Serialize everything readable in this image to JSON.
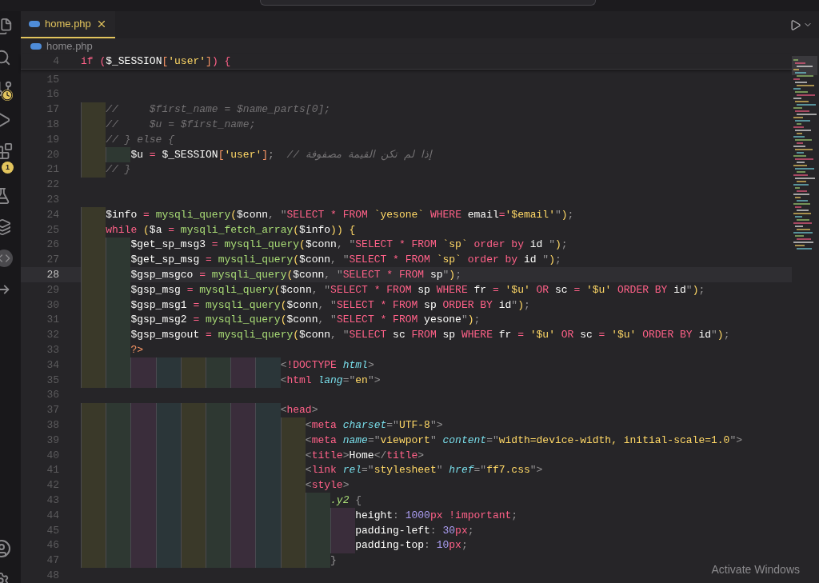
{
  "tabs": [
    {
      "label": "home.php",
      "selected": true
    }
  ],
  "breadcrumb": "home.php",
  "activity_bar": {
    "badge": "1"
  },
  "sticky_scroll": {
    "number": "4",
    "tokens": [
      {
        "kind": "keyword",
        "text": "if"
      },
      {
        "kind": "keyword",
        "text": " ("
      },
      {
        "kind": "variable",
        "text": "$_SESSION"
      },
      {
        "kind": "php",
        "text": "["
      },
      {
        "kind": "string",
        "text": "'user'"
      },
      {
        "kind": "php",
        "text": "]"
      },
      {
        "kind": "keyword",
        "text": ") {"
      }
    ]
  },
  "lines": [
    {
      "number": "15",
      "current": false
    },
    {
      "number": "16",
      "current": false
    },
    {
      "number": "17",
      "current": false,
      "guides": [
        {
          "color": "#3a3929"
        }
      ],
      "tokens": [
        {
          "kind": "comment",
          "text": "//     $first_name = $name_parts[0];"
        }
      ]
    },
    {
      "number": "18",
      "current": false,
      "guides": [
        {
          "color": "#3a3929"
        }
      ],
      "tokens": [
        {
          "kind": "comment",
          "text": "//     $u = $first_name;"
        }
      ]
    },
    {
      "number": "19",
      "current": false,
      "guides": [
        {
          "color": "#3a3929"
        }
      ],
      "tokens": [
        {
          "kind": "comment",
          "text": "// } else {"
        }
      ]
    },
    {
      "number": "20",
      "current": false,
      "guides": [
        {
          "color": "#3a3929"
        },
        {
          "color": "#2e3832"
        }
      ],
      "tokens": [
        {
          "kind": "variable",
          "text": "$u"
        },
        {
          "kind": "keyword",
          "text": " = "
        },
        {
          "kind": "variable",
          "text": "$_SESSION"
        },
        {
          "kind": "php",
          "text": "["
        },
        {
          "kind": "string",
          "text": "'user'"
        },
        {
          "kind": "php",
          "text": "]"
        },
        {
          "kind": "punctuation",
          "text": ";  "
        },
        {
          "kind": "comment",
          "text": "// إذا لم تكن القيمة مصفوفة"
        }
      ]
    },
    {
      "number": "21",
      "current": false,
      "guides": [
        {
          "color": "#3a3929"
        }
      ],
      "tokens": [
        {
          "kind": "comment",
          "text": "// }"
        }
      ]
    },
    {
      "number": "22",
      "current": false
    },
    {
      "number": "23",
      "current": false
    },
    {
      "number": "24",
      "current": false,
      "guides": [
        {
          "color": "#3a3929"
        }
      ],
      "tokens": [
        {
          "kind": "variable",
          "text": "$info"
        },
        {
          "kind": "keyword",
          "text": " = "
        },
        {
          "kind": "function",
          "text": "mysqli_query"
        },
        {
          "kind": "bracket",
          "text": "("
        },
        {
          "kind": "variable",
          "text": "$conn"
        },
        {
          "kind": "punctuation",
          "text": ", \""
        },
        {
          "kind": "keyword",
          "text": "SELECT * FROM "
        },
        {
          "kind": "string",
          "text": "`yesone`"
        },
        {
          "kind": "keyword",
          "text": " WHERE "
        },
        {
          "kind": "variable",
          "text": "email"
        },
        {
          "kind": "keyword",
          "text": "="
        },
        {
          "kind": "string",
          "text": "'$email'"
        },
        {
          "kind": "punctuation",
          "text": "\""
        },
        {
          "kind": "bracket",
          "text": ")"
        },
        {
          "kind": "punctuation",
          "text": ";"
        }
      ]
    },
    {
      "number": "25",
      "current": false,
      "guides": [
        {
          "color": "#3a3929"
        }
      ],
      "tokens": [
        {
          "kind": "keyword",
          "text": "while "
        },
        {
          "kind": "bracket",
          "text": "("
        },
        {
          "kind": "variable",
          "text": "$a"
        },
        {
          "kind": "keyword",
          "text": " = "
        },
        {
          "kind": "function",
          "text": "mysqli_fetch_array"
        },
        {
          "kind": "bracket",
          "text": "("
        },
        {
          "kind": "variable",
          "text": "$info"
        },
        {
          "kind": "bracket",
          "text": ")) {"
        }
      ]
    },
    {
      "number": "26",
      "current": false,
      "guides": [
        {
          "color": "#3a3929"
        },
        {
          "color": "#2e3832"
        }
      ],
      "tokens": [
        {
          "kind": "variable",
          "text": "$get_sp_msg3"
        },
        {
          "kind": "keyword",
          "text": " = "
        },
        {
          "kind": "function",
          "text": "mysqli_query"
        },
        {
          "kind": "bracket",
          "text": "("
        },
        {
          "kind": "variable",
          "text": "$conn"
        },
        {
          "kind": "punctuation",
          "text": ", \""
        },
        {
          "kind": "keyword",
          "text": "SELECT * FROM "
        },
        {
          "kind": "string",
          "text": "`sp`"
        },
        {
          "kind": "keyword",
          "text": " order by "
        },
        {
          "kind": "variable",
          "text": "id "
        },
        {
          "kind": "punctuation",
          "text": "\""
        },
        {
          "kind": "bracket",
          "text": ")"
        },
        {
          "kind": "punctuation",
          "text": ";"
        }
      ]
    },
    {
      "number": "27",
      "current": false,
      "guides": [
        {
          "color": "#3a3929"
        },
        {
          "color": "#2e3832"
        }
      ],
      "tokens": [
        {
          "kind": "variable",
          "text": "$get_sp_msg"
        },
        {
          "kind": "keyword",
          "text": " = "
        },
        {
          "kind": "function",
          "text": "mysqli_query"
        },
        {
          "kind": "bracket",
          "text": "("
        },
        {
          "kind": "variable",
          "text": "$conn"
        },
        {
          "kind": "punctuation",
          "text": ", \""
        },
        {
          "kind": "keyword",
          "text": "SELECT * FROM "
        },
        {
          "kind": "string",
          "text": "`sp`"
        },
        {
          "kind": "keyword",
          "text": " order by "
        },
        {
          "kind": "variable",
          "text": "id "
        },
        {
          "kind": "punctuation",
          "text": "\""
        },
        {
          "kind": "bracket",
          "text": ")"
        },
        {
          "kind": "punctuation",
          "text": ";"
        }
      ]
    },
    {
      "number": "28",
      "current": true,
      "guides": [
        {
          "color": "#3a3929"
        },
        {
          "color": "#2e3832"
        }
      ],
      "tokens": [
        {
          "kind": "variable",
          "text": "$gsp_msgco"
        },
        {
          "kind": "keyword",
          "text": " = "
        },
        {
          "kind": "function",
          "text": "mysqli_query"
        },
        {
          "kind": "bracket",
          "text": "("
        },
        {
          "kind": "variable",
          "text": "$conn"
        },
        {
          "kind": "punctuation",
          "text": ", \""
        },
        {
          "kind": "keyword",
          "text": "SELECT * FROM "
        },
        {
          "kind": "variable",
          "text": "sp"
        },
        {
          "kind": "punctuation",
          "text": "\""
        },
        {
          "kind": "bracket",
          "text": ")"
        },
        {
          "kind": "punctuation",
          "text": ";"
        }
      ]
    },
    {
      "number": "29",
      "current": false,
      "guides": [
        {
          "color": "#3a3929"
        },
        {
          "color": "#2e3832"
        }
      ],
      "tokens": [
        {
          "kind": "variable",
          "text": "$gsp_msg"
        },
        {
          "kind": "keyword",
          "text": " = "
        },
        {
          "kind": "function",
          "text": "mysqli_query"
        },
        {
          "kind": "bracket",
          "text": "("
        },
        {
          "kind": "variable",
          "text": "$conn"
        },
        {
          "kind": "punctuation",
          "text": ", \""
        },
        {
          "kind": "keyword",
          "text": "SELECT * FROM "
        },
        {
          "kind": "variable",
          "text": "sp "
        },
        {
          "kind": "keyword",
          "text": "WHERE "
        },
        {
          "kind": "variable",
          "text": "fr "
        },
        {
          "kind": "keyword",
          "text": "= "
        },
        {
          "kind": "string",
          "text": "'$u' "
        },
        {
          "kind": "keyword",
          "text": "OR "
        },
        {
          "kind": "variable",
          "text": "sc "
        },
        {
          "kind": "keyword",
          "text": "= "
        },
        {
          "kind": "string",
          "text": "'$u' "
        },
        {
          "kind": "keyword",
          "text": "ORDER BY "
        },
        {
          "kind": "variable",
          "text": "id"
        },
        {
          "kind": "punctuation",
          "text": "\""
        },
        {
          "kind": "bracket",
          "text": ")"
        },
        {
          "kind": "punctuation",
          "text": ";"
        }
      ]
    },
    {
      "number": "30",
      "current": false,
      "guides": [
        {
          "color": "#3a3929"
        },
        {
          "color": "#2e3832"
        }
      ],
      "tokens": [
        {
          "kind": "variable",
          "text": "$gsp_msg1"
        },
        {
          "kind": "keyword",
          "text": " = "
        },
        {
          "kind": "function",
          "text": "mysqli_query"
        },
        {
          "kind": "bracket",
          "text": "("
        },
        {
          "kind": "variable",
          "text": "$conn"
        },
        {
          "kind": "punctuation",
          "text": ", \""
        },
        {
          "kind": "keyword",
          "text": "SELECT * FROM "
        },
        {
          "kind": "variable",
          "text": "sp "
        },
        {
          "kind": "keyword",
          "text": "ORDER BY "
        },
        {
          "kind": "variable",
          "text": "id"
        },
        {
          "kind": "punctuation",
          "text": "\""
        },
        {
          "kind": "bracket",
          "text": ")"
        },
        {
          "kind": "punctuation",
          "text": ";"
        }
      ]
    },
    {
      "number": "31",
      "current": false,
      "guides": [
        {
          "color": "#3a3929"
        },
        {
          "color": "#2e3832"
        }
      ],
      "tokens": [
        {
          "kind": "variable",
          "text": "$gsp_msg2"
        },
        {
          "kind": "keyword",
          "text": " = "
        },
        {
          "kind": "function",
          "text": "mysqli_query"
        },
        {
          "kind": "bracket",
          "text": "("
        },
        {
          "kind": "variable",
          "text": "$conn"
        },
        {
          "kind": "punctuation",
          "text": ", \""
        },
        {
          "kind": "keyword",
          "text": "SELECT * FROM "
        },
        {
          "kind": "variable",
          "text": "yesone"
        },
        {
          "kind": "punctuation",
          "text": "\""
        },
        {
          "kind": "bracket",
          "text": ")"
        },
        {
          "kind": "punctuation",
          "text": ";"
        }
      ]
    },
    {
      "number": "32",
      "current": false,
      "guides": [
        {
          "color": "#3a3929"
        },
        {
          "color": "#2e3832"
        }
      ],
      "tokens": [
        {
          "kind": "variable",
          "text": "$gsp_msgout"
        },
        {
          "kind": "keyword",
          "text": " = "
        },
        {
          "kind": "function",
          "text": "mysqli_query"
        },
        {
          "kind": "bracket",
          "text": "("
        },
        {
          "kind": "variable",
          "text": "$conn"
        },
        {
          "kind": "punctuation",
          "text": ", \""
        },
        {
          "kind": "keyword",
          "text": "SELECT "
        },
        {
          "kind": "variable",
          "text": "sc "
        },
        {
          "kind": "keyword",
          "text": "FROM "
        },
        {
          "kind": "variable",
          "text": "sp "
        },
        {
          "kind": "keyword",
          "text": "WHERE "
        },
        {
          "kind": "variable",
          "text": "fr "
        },
        {
          "kind": "keyword",
          "text": "= "
        },
        {
          "kind": "string",
          "text": "'$u' "
        },
        {
          "kind": "keyword",
          "text": "OR "
        },
        {
          "kind": "variable",
          "text": "sc "
        },
        {
          "kind": "keyword",
          "text": "= "
        },
        {
          "kind": "string",
          "text": "'$u' "
        },
        {
          "kind": "keyword",
          "text": "ORDER BY "
        },
        {
          "kind": "variable",
          "text": "id"
        },
        {
          "kind": "punctuation",
          "text": "\""
        },
        {
          "kind": "bracket",
          "text": ")"
        },
        {
          "kind": "punctuation",
          "text": ";"
        }
      ]
    },
    {
      "number": "33",
      "current": false,
      "guides": [
        {
          "color": "#3a3929"
        },
        {
          "color": "#2e3832"
        }
      ],
      "tokens": [
        {
          "kind": "php",
          "text": "?>"
        }
      ]
    },
    {
      "number": "34",
      "current": false,
      "guides": [
        {
          "color": "#3a3929"
        },
        {
          "color": "#2e3832"
        },
        {
          "color": "#3a2d3b"
        },
        {
          "color": "#2b3639"
        },
        {
          "color": "#3a3929"
        },
        {
          "color": "#2e3832"
        },
        {
          "color": "#3a2d3b"
        },
        {
          "color": "#2b3639"
        }
      ],
      "tokens": [
        {
          "kind": "punctuation",
          "text": "<"
        },
        {
          "kind": "keyword",
          "text": "!DOCTYPE "
        },
        {
          "kind": "attribute",
          "text": "html"
        },
        {
          "kind": "punctuation",
          "text": ">"
        }
      ]
    },
    {
      "number": "35",
      "current": false,
      "guides": [
        {
          "color": "#3a3929"
        },
        {
          "color": "#2e3832"
        },
        {
          "color": "#3a2d3b"
        },
        {
          "color": "#2b3639"
        },
        {
          "color": "#3a3929"
        },
        {
          "color": "#2e3832"
        },
        {
          "color": "#3a2d3b"
        },
        {
          "color": "#2b3639"
        }
      ],
      "tokens": [
        {
          "kind": "punctuation",
          "text": "<"
        },
        {
          "kind": "keyword",
          "text": "html "
        },
        {
          "kind": "attribute",
          "text": "lang"
        },
        {
          "kind": "punctuation",
          "text": "=\""
        },
        {
          "kind": "string",
          "text": "en"
        },
        {
          "kind": "punctuation",
          "text": "\">"
        }
      ]
    },
    {
      "number": "36",
      "current": false
    },
    {
      "number": "37",
      "current": false,
      "guides": [
        {
          "color": "#3a3929"
        },
        {
          "color": "#2e3832"
        },
        {
          "color": "#3a2d3b"
        },
        {
          "color": "#2b3639"
        },
        {
          "color": "#3a3929"
        },
        {
          "color": "#2e3832"
        },
        {
          "color": "#3a2d3b"
        },
        {
          "color": "#2b3639"
        }
      ],
      "tokens": [
        {
          "kind": "punctuation",
          "text": "<"
        },
        {
          "kind": "keyword",
          "text": "head"
        },
        {
          "kind": "punctuation",
          "text": ">"
        }
      ]
    },
    {
      "number": "38",
      "current": false,
      "guides": [
        {
          "color": "#3a3929"
        },
        {
          "color": "#2e3832"
        },
        {
          "color": "#3a2d3b"
        },
        {
          "color": "#2b3639"
        },
        {
          "color": "#3a3929"
        },
        {
          "color": "#2e3832"
        },
        {
          "color": "#3a2d3b"
        },
        {
          "color": "#2b3639"
        },
        {
          "color": "#3a3929"
        }
      ],
      "tokens": [
        {
          "kind": "punctuation",
          "text": "<"
        },
        {
          "kind": "keyword",
          "text": "meta "
        },
        {
          "kind": "attribute",
          "text": "charset"
        },
        {
          "kind": "punctuation",
          "text": "=\""
        },
        {
          "kind": "string",
          "text": "UTF-8"
        },
        {
          "kind": "punctuation",
          "text": "\">"
        }
      ]
    },
    {
      "number": "39",
      "current": false,
      "guides": [
        {
          "color": "#3a3929"
        },
        {
          "color": "#2e3832"
        },
        {
          "color": "#3a2d3b"
        },
        {
          "color": "#2b3639"
        },
        {
          "color": "#3a3929"
        },
        {
          "color": "#2e3832"
        },
        {
          "color": "#3a2d3b"
        },
        {
          "color": "#2b3639"
        },
        {
          "color": "#3a3929"
        }
      ],
      "tokens": [
        {
          "kind": "punctuation",
          "text": "<"
        },
        {
          "kind": "keyword",
          "text": "meta "
        },
        {
          "kind": "attribute",
          "text": "name"
        },
        {
          "kind": "punctuation",
          "text": "=\""
        },
        {
          "kind": "string",
          "text": "viewport"
        },
        {
          "kind": "punctuation",
          "text": "\" "
        },
        {
          "kind": "attribute",
          "text": "content"
        },
        {
          "kind": "punctuation",
          "text": "=\""
        },
        {
          "kind": "string",
          "text": "width=device-width, initial-scale=1.0"
        },
        {
          "kind": "punctuation",
          "text": "\">"
        }
      ]
    },
    {
      "number": "40",
      "current": false,
      "guides": [
        {
          "color": "#3a3929"
        },
        {
          "color": "#2e3832"
        },
        {
          "color": "#3a2d3b"
        },
        {
          "color": "#2b3639"
        },
        {
          "color": "#3a3929"
        },
        {
          "color": "#2e3832"
        },
        {
          "color": "#3a2d3b"
        },
        {
          "color": "#2b3639"
        },
        {
          "color": "#3a3929"
        }
      ],
      "tokens": [
        {
          "kind": "punctuation",
          "text": "<"
        },
        {
          "kind": "keyword",
          "text": "title"
        },
        {
          "kind": "punctuation",
          "text": ">"
        },
        {
          "kind": "variable",
          "text": "Home"
        },
        {
          "kind": "punctuation",
          "text": "</"
        },
        {
          "kind": "keyword",
          "text": "title"
        },
        {
          "kind": "punctuation",
          "text": ">"
        }
      ]
    },
    {
      "number": "41",
      "current": false,
      "guides": [
        {
          "color": "#3a3929"
        },
        {
          "color": "#2e3832"
        },
        {
          "color": "#3a2d3b"
        },
        {
          "color": "#2b3639"
        },
        {
          "color": "#3a3929"
        },
        {
          "color": "#2e3832"
        },
        {
          "color": "#3a2d3b"
        },
        {
          "color": "#2b3639"
        },
        {
          "color": "#3a3929"
        }
      ],
      "tokens": [
        {
          "kind": "punctuation",
          "text": "<"
        },
        {
          "kind": "keyword",
          "text": "link "
        },
        {
          "kind": "attribute",
          "text": "rel"
        },
        {
          "kind": "punctuation",
          "text": "=\""
        },
        {
          "kind": "string",
          "text": "stylesheet"
        },
        {
          "kind": "punctuation",
          "text": "\" "
        },
        {
          "kind": "attribute",
          "text": "href"
        },
        {
          "kind": "punctuation",
          "text": "=\""
        },
        {
          "kind": "string",
          "text": "ff7.css"
        },
        {
          "kind": "punctuation",
          "text": "\">"
        }
      ]
    },
    {
      "number": "42",
      "current": false,
      "guides": [
        {
          "color": "#3a3929"
        },
        {
          "color": "#2e3832"
        },
        {
          "color": "#3a2d3b"
        },
        {
          "color": "#2b3639"
        },
        {
          "color": "#3a3929"
        },
        {
          "color": "#2e3832"
        },
        {
          "color": "#3a2d3b"
        },
        {
          "color": "#2b3639"
        },
        {
          "color": "#3a3929"
        }
      ],
      "tokens": [
        {
          "kind": "punctuation",
          "text": "<"
        },
        {
          "kind": "keyword",
          "text": "style"
        },
        {
          "kind": "punctuation",
          "text": ">"
        }
      ]
    },
    {
      "number": "43",
      "current": false,
      "guides": [
        {
          "color": "#3a3929"
        },
        {
          "color": "#2e3832"
        },
        {
          "color": "#3a2d3b"
        },
        {
          "color": "#2b3639"
        },
        {
          "color": "#3a3929"
        },
        {
          "color": "#2e3832"
        },
        {
          "color": "#3a2d3b"
        },
        {
          "color": "#2b3639"
        },
        {
          "color": "#3a3929"
        },
        {
          "color": "#2e3832"
        }
      ],
      "tokens": [
        {
          "kind": "selector",
          "text": ".y2"
        },
        {
          "kind": "punctuation",
          "text": " {"
        }
      ]
    },
    {
      "number": "44",
      "current": false,
      "guides": [
        {
          "color": "#3a3929"
        },
        {
          "color": "#2e3832"
        },
        {
          "color": "#3a2d3b"
        },
        {
          "color": "#2b3639"
        },
        {
          "color": "#3a3929"
        },
        {
          "color": "#2e3832"
        },
        {
          "color": "#3a2d3b"
        },
        {
          "color": "#2b3639"
        },
        {
          "color": "#3a3929"
        },
        {
          "color": "#2e3832"
        },
        {
          "color": "#3a2d3b"
        }
      ],
      "tokens": [
        {
          "kind": "variable",
          "text": "height"
        },
        {
          "kind": "punctuation",
          "text": ": "
        },
        {
          "kind": "number",
          "text": "1000"
        },
        {
          "kind": "keyword",
          "text": "px !important"
        },
        {
          "kind": "punctuation",
          "text": ";"
        }
      ]
    },
    {
      "number": "45",
      "current": false,
      "guides": [
        {
          "color": "#3a3929"
        },
        {
          "color": "#2e3832"
        },
        {
          "color": "#3a2d3b"
        },
        {
          "color": "#2b3639"
        },
        {
          "color": "#3a3929"
        },
        {
          "color": "#2e3832"
        },
        {
          "color": "#3a2d3b"
        },
        {
          "color": "#2b3639"
        },
        {
          "color": "#3a3929"
        },
        {
          "color": "#2e3832"
        },
        {
          "color": "#3a2d3b"
        }
      ],
      "tokens": [
        {
          "kind": "variable",
          "text": "padding-left"
        },
        {
          "kind": "punctuation",
          "text": ": "
        },
        {
          "kind": "number",
          "text": "30"
        },
        {
          "kind": "keyword",
          "text": "px"
        },
        {
          "kind": "punctuation",
          "text": ";"
        }
      ]
    },
    {
      "number": "46",
      "current": false,
      "guides": [
        {
          "color": "#3a3929"
        },
        {
          "color": "#2e3832"
        },
        {
          "color": "#3a2d3b"
        },
        {
          "color": "#2b3639"
        },
        {
          "color": "#3a3929"
        },
        {
          "color": "#2e3832"
        },
        {
          "color": "#3a2d3b"
        },
        {
          "color": "#2b3639"
        },
        {
          "color": "#3a3929"
        },
        {
          "color": "#2e3832"
        },
        {
          "color": "#3a2d3b"
        }
      ],
      "tokens": [
        {
          "kind": "variable",
          "text": "padding-top"
        },
        {
          "kind": "punctuation",
          "text": ": "
        },
        {
          "kind": "number",
          "text": "10"
        },
        {
          "kind": "keyword",
          "text": "px"
        },
        {
          "kind": "punctuation",
          "text": ";"
        }
      ]
    },
    {
      "number": "47",
      "current": false,
      "guides": [
        {
          "color": "#3a3929"
        },
        {
          "color": "#2e3832"
        },
        {
          "color": "#3a2d3b"
        },
        {
          "color": "#2b3639"
        },
        {
          "color": "#3a3929"
        },
        {
          "color": "#2e3832"
        },
        {
          "color": "#3a2d3b"
        },
        {
          "color": "#2b3639"
        },
        {
          "color": "#3a3929"
        },
        {
          "color": "#2e3832"
        }
      ],
      "tokens": [
        {
          "kind": "punctuation",
          "text": "}"
        }
      ]
    },
    {
      "number": "48",
      "current": false
    }
  ],
  "os_notice": "Activate Windows"
}
